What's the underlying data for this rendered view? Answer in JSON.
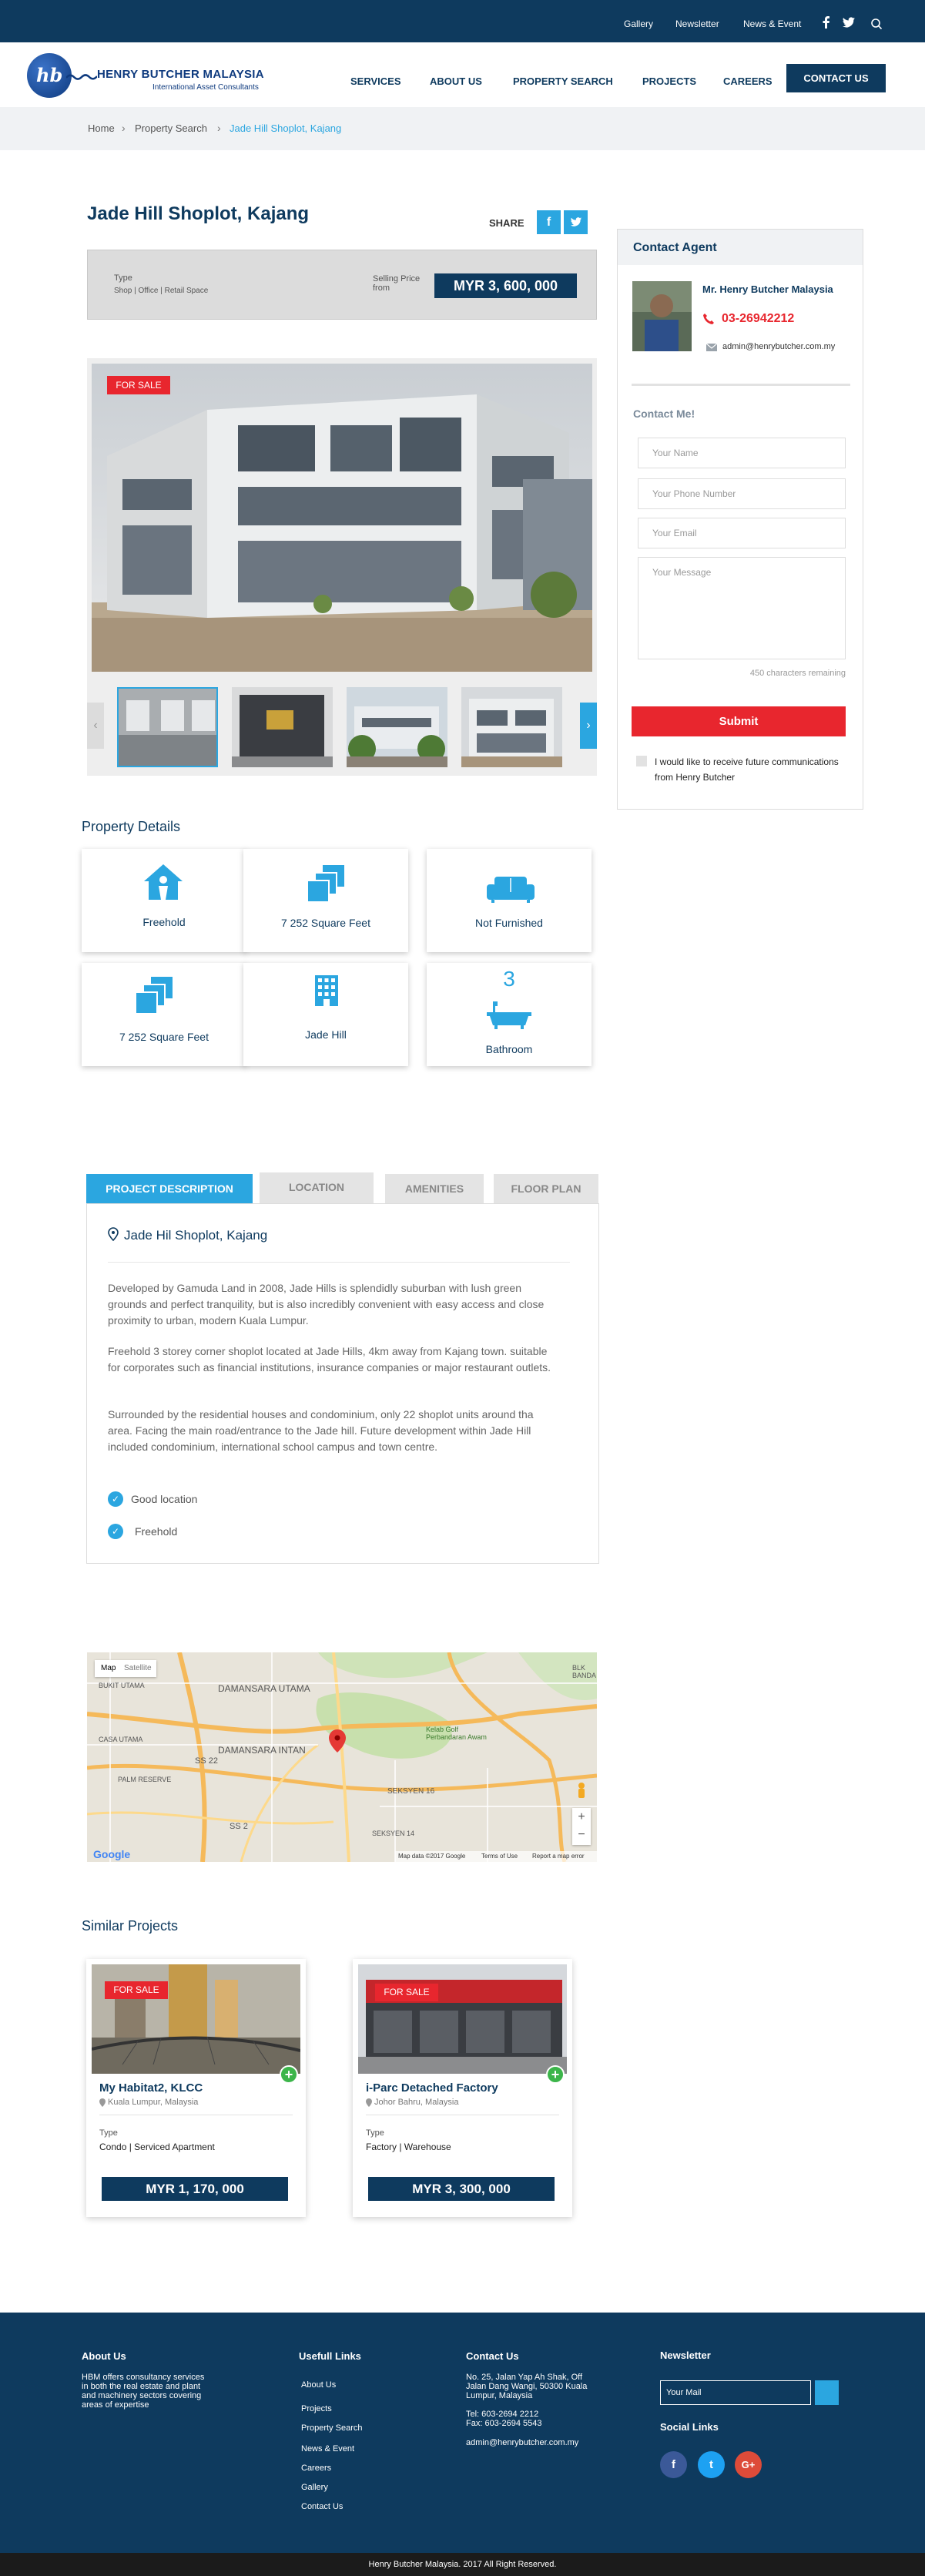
{
  "topbar": {
    "links": [
      "Gallery",
      "Newsletter",
      "News & Event"
    ],
    "icons": [
      "facebook-icon",
      "twitter-icon",
      "search-icon"
    ]
  },
  "brand": {
    "logo_mark": "hb",
    "name": "HENRY BUTCHER MALAYSIA",
    "tagline": "International Asset Consultants"
  },
  "nav": {
    "items": [
      "SERVICES",
      "ABOUT US",
      "PROPERTY SEARCH",
      "PROJECTS",
      "CAREERS"
    ],
    "cta": "CONTACT US"
  },
  "breadcrumb": [
    "Home",
    "Property Search",
    "Jade Hill Shoplot, Kajang"
  ],
  "property": {
    "title": "Jade Hill Shoplot, Kajang",
    "share_label": "SHARE",
    "type_label": "Type",
    "type_value": "Shop | Office | Retail Space",
    "selling_label": "Selling Price",
    "from_label": "from",
    "price": "MYR 3, 600, 000",
    "badge": "FOR SALE"
  },
  "agent": {
    "heading": "Contact Agent",
    "name": "Mr. Henry Butcher Malaysia",
    "phone": "03-26942212",
    "email": "admin@henrybutcher.com.my",
    "contact_me": "Contact Me!",
    "form": {
      "name_placeholder": "Your Name",
      "phone_placeholder": "Your Phone Number",
      "email_placeholder": "Your Email",
      "message_placeholder": "Your Message",
      "chars_remaining": "450 characters remaining",
      "submit": "Submit",
      "consent": "I would like to receive future communications from Henry Butcher"
    }
  },
  "details": {
    "title": "Property Details",
    "cards": [
      {
        "label": "Freehold",
        "icon": "house-person-icon"
      },
      {
        "label": "7 252 Square Feet",
        "icon": "area-icon"
      },
      {
        "label": "Not Furnished",
        "icon": "sofa-icon"
      },
      {
        "label": "7 252 Square Feet",
        "icon": "area-icon"
      },
      {
        "label": "Jade Hill",
        "icon": "building-icon"
      },
      {
        "label": "Bathroom",
        "icon": "bathtub-icon",
        "count": "3"
      }
    ]
  },
  "tabs": {
    "items": [
      "PROJECT DESCRIPTION",
      "LOCATION",
      "AMENITIES",
      "FLOOR PLAN"
    ],
    "active": 0,
    "heading": "Jade Hil Shoplot, Kajang",
    "paragraphs": [
      "Developed by Gamuda Land in 2008, Jade Hills is splendidly suburban with lush green grounds and perfect tranquility, but is also incredibly convenient with easy access and close proximity to urban, modern Kuala Lumpur.",
      "Freehold 3 storey corner shoplot located at Jade Hills, 4km away from Kajang town. suitable for corporates such as financial institutions, insurance companies or major restaurant outlets.",
      "Surrounded by the residential houses and condominium, only 22 shoplot units around tha area. Facing the main road/entrance to the Jade hill. Future development within Jade Hill included condominium, international school campus and town centre."
    ],
    "highlights": [
      "Good location",
      "Freehold"
    ]
  },
  "map": {
    "map_btn": "Map",
    "satellite_btn": "Satellite",
    "labels": [
      "BUKIT UTAMA",
      "DAMANSARA UTAMA",
      "Kelab Golf Perbandaran Awam",
      "DAMANSARA INTAN",
      "CASA UTAMA",
      "PALM RESERVE",
      "SEKSYEN 16",
      "SS 22",
      "SS 2",
      "SEKSYEN 14",
      "BLK BANDA"
    ],
    "attribution": "Map data ©2017 Google",
    "terms": "Terms of Use",
    "report": "Report a map error",
    "google": "Google"
  },
  "similar": {
    "title": "Similar Projects",
    "items": [
      {
        "badge": "FOR SALE",
        "name": "My Habitat2, KLCC",
        "location": "Kuala Lumpur, Malaysia",
        "type_label": "Type",
        "type": "Condo  |  Serviced Apartment",
        "price": "MYR 1, 170, 000"
      },
      {
        "badge": "FOR SALE",
        "name": "i-Parc Detached Factory",
        "location": "Johor Bahru, Malaysia",
        "type_label": "Type",
        "type": "Factory  |  Warehouse",
        "price": "MYR 3, 300, 000"
      }
    ]
  },
  "footer": {
    "about_title": "About Us",
    "about_text": "HBM offers consultancy services in both the real estate and plant and machinery sectors covering areas of expertise",
    "links_title": "Usefull Links",
    "links": [
      "About Us",
      "Projects",
      "Property Search",
      "News & Event",
      "Careers",
      "Gallery",
      "Contact Us"
    ],
    "contact_title": "Contact Us",
    "address": "No. 25, Jalan Yap Ah Shak, Off Jalan Dang Wangi, 50300 Kuala Lumpur, Malaysia",
    "tel": "Tel: 603-2694 2212",
    "fax": "Fax: 603-2694 5543",
    "email": "admin@henrybutcher.com.my",
    "newsletter_title": "Newsletter",
    "newsletter_placeholder": "Your Mail",
    "social_title": "Social Links",
    "social": [
      {
        "name": "facebook",
        "glyph": "f",
        "color": "#3b5998"
      },
      {
        "name": "twitter",
        "glyph": "t",
        "color": "#1da1f2"
      },
      {
        "name": "google-plus",
        "glyph": "G+",
        "color": "#dd4b39"
      }
    ],
    "copyright": "Henry Butcher Malaysia. 2017 All Right Reserved."
  },
  "colors": {
    "navy": "#0e3a5e",
    "accent": "#2ba6e0",
    "red": "#e8262e",
    "green": "#3cb54a"
  }
}
